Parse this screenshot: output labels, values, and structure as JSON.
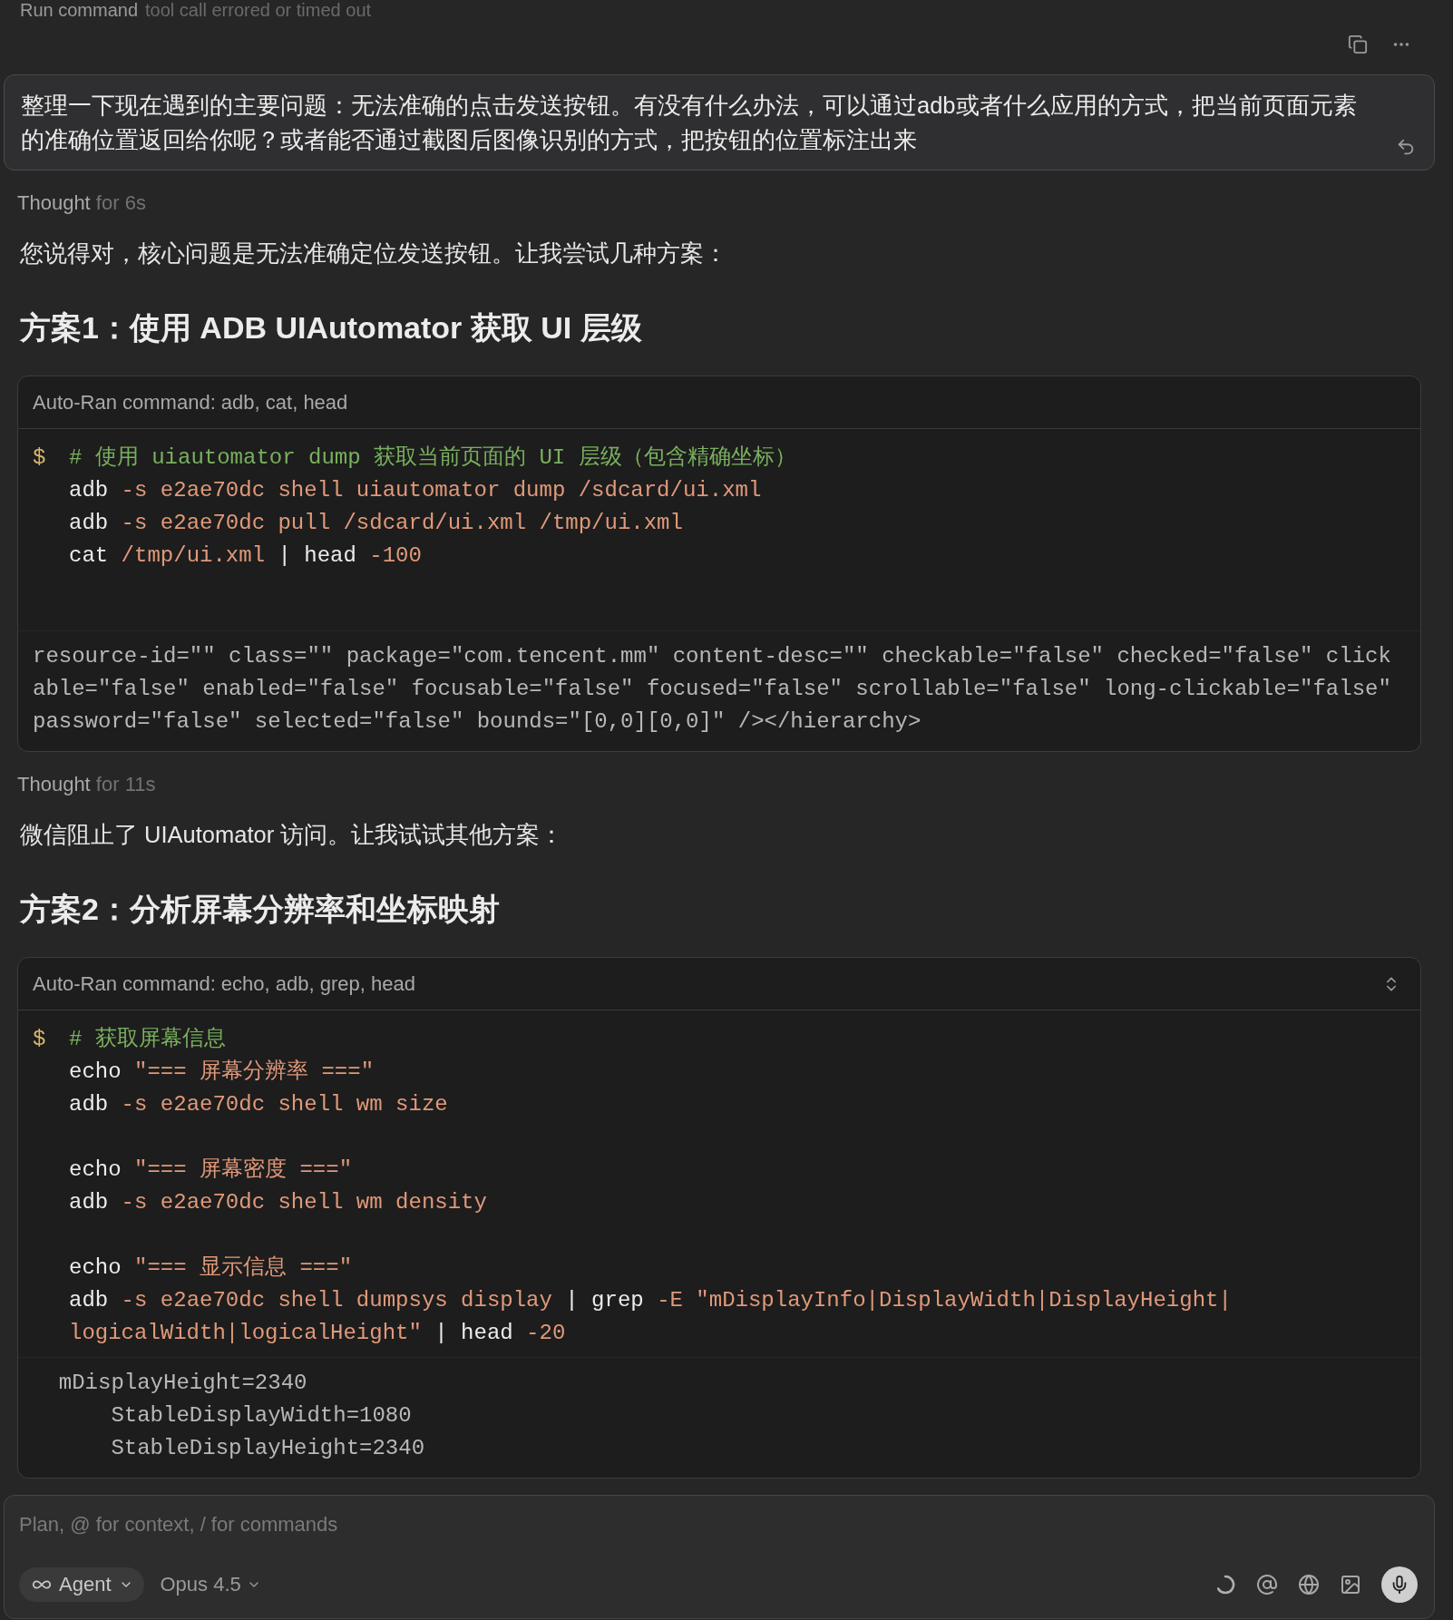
{
  "status_line": {
    "title": "Run command",
    "detail": "tool call errored or timed out"
  },
  "user_message": {
    "text": "整理一下现在遇到的主要问题：无法准确的点击发送按钮。有没有什么办法，可以通过adb或者什么应用的方式，把当前页面元素的准确位置返回给你呢？或者能否通过截图后图像识别的方式，把按钮的位置标注出来"
  },
  "blocks": [
    {
      "kind": "thought",
      "label": "Thought",
      "duration": "for 6s"
    },
    {
      "kind": "paragraph",
      "text": "您说得对，核心问题是无法准确定位发送按钮。让我尝试几种方案："
    },
    {
      "kind": "heading",
      "text": "方案1：使用 ADB UIAutomator 获取 UI 层级"
    },
    {
      "kind": "command",
      "title": "Auto-Ran command: adb, cat, head",
      "expandable": false,
      "prompt": "$",
      "line_groups": [
        [
          {
            "segments": [
              {
                "kind": "comment",
                "text": "# 使用 uiautomator dump 获取当前页面的 UI 层级（包含精确坐标）"
              }
            ]
          },
          {
            "segments": [
              {
                "kind": "plain",
                "text": "adb"
              },
              {
                "kind": "arg",
                "text": " -s e2ae70dc shell uiautomator dump /sdcard/ui.xml"
              }
            ]
          },
          {
            "segments": [
              {
                "kind": "plain",
                "text": "adb"
              },
              {
                "kind": "arg",
                "text": " -s e2ae70dc pull /sdcard/ui.xml /tmp/ui.xml"
              }
            ]
          },
          {
            "segments": [
              {
                "kind": "plain",
                "text": "cat"
              },
              {
                "kind": "arg",
                "text": " /tmp/ui.xml"
              },
              {
                "kind": "plain",
                "text": " | head"
              },
              {
                "kind": "arg",
                "text": " -100"
              }
            ]
          }
        ]
      ],
      "output": [
        "resource-id=\"\" class=\"\" package=\"com.tencent.mm\" content-desc=\"\" checkable=\"false\" checked=\"false\" click",
        "able=\"false\" enabled=\"false\" focusable=\"false\" focused=\"false\" scrollable=\"false\" long-clickable=\"false\"",
        "password=\"false\" selected=\"false\" bounds=\"[0,0][0,0]\" /></hierarchy>"
      ]
    },
    {
      "kind": "thought",
      "label": "Thought",
      "duration": "for 11s"
    },
    {
      "kind": "paragraph",
      "text": "微信阻止了 UIAutomator 访问。让我试试其他方案："
    },
    {
      "kind": "heading",
      "text": "方案2：分析屏幕分辨率和坐标映射"
    },
    {
      "kind": "command",
      "title": "Auto-Ran command: echo, adb, grep, head",
      "expandable": true,
      "prompt": "$",
      "line_groups": [
        [
          {
            "segments": [
              {
                "kind": "comment",
                "text": "# 获取屏幕信息"
              }
            ]
          },
          {
            "segments": [
              {
                "kind": "plain",
                "text": "echo"
              },
              {
                "kind": "arg",
                "text": " \"=== 屏幕分辨率 ===\""
              }
            ]
          },
          {
            "segments": [
              {
                "kind": "plain",
                "text": "adb"
              },
              {
                "kind": "arg",
                "text": " -s e2ae70dc shell wm size"
              }
            ]
          }
        ],
        [
          {
            "segments": [
              {
                "kind": "plain",
                "text": "echo"
              },
              {
                "kind": "arg",
                "text": " \"=== 屏幕密度 ===\""
              }
            ]
          },
          {
            "segments": [
              {
                "kind": "plain",
                "text": "adb"
              },
              {
                "kind": "arg",
                "text": " -s e2ae70dc shell wm density"
              }
            ]
          }
        ],
        [
          {
            "segments": [
              {
                "kind": "plain",
                "text": "echo"
              },
              {
                "kind": "arg",
                "text": " \"=== 显示信息 ===\""
              }
            ]
          },
          {
            "segments": [
              {
                "kind": "plain",
                "text": "adb"
              },
              {
                "kind": "arg",
                "text": " -s e2ae70dc shell dumpsys display"
              },
              {
                "kind": "plain",
                "text": " | grep"
              },
              {
                "kind": "arg",
                "text": " -E \"mDisplayInfo|DisplayWidth|DisplayHeight|"
              }
            ]
          },
          {
            "segments": [
              {
                "kind": "arg",
                "text": "logicalWidth|logicalHeight\""
              },
              {
                "kind": "plain",
                "text": " | head"
              },
              {
                "kind": "arg",
                "text": " -20"
              }
            ]
          }
        ]
      ],
      "output": [
        "  mDisplayHeight=2340",
        "      StableDisplayWidth=1080",
        "      StableDisplayHeight=2340"
      ]
    }
  ],
  "composer": {
    "placeholder": "Plan, @ for context, / for commands",
    "mode": "Agent",
    "model": "Opus 4.5"
  }
}
